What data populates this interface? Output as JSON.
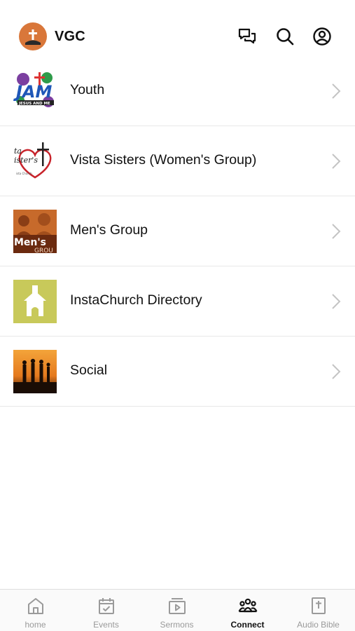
{
  "header": {
    "brand": "VGC",
    "icons": [
      "chat-icon",
      "search-icon",
      "account-icon"
    ]
  },
  "list": [
    {
      "label": "Youth",
      "thumb": "jam-logo"
    },
    {
      "label": "Vista Sisters (Women's Group)",
      "thumb": "heart-cross-logo"
    },
    {
      "label": "Men's Group",
      "thumb": "mens-group-photo"
    },
    {
      "label": "InstaChurch Directory",
      "thumb": "church-icon"
    },
    {
      "label": "Social",
      "thumb": "sunset-silhouette-photo"
    }
  ],
  "tabs": [
    {
      "label": "home",
      "icon": "home-icon",
      "active": false
    },
    {
      "label": "Events",
      "icon": "calendar-icon",
      "active": false
    },
    {
      "label": "Sermons",
      "icon": "video-icon",
      "active": false
    },
    {
      "label": "Connect",
      "icon": "people-icon",
      "active": true
    },
    {
      "label": "Audio Bible",
      "icon": "bible-icon",
      "active": false
    }
  ],
  "colors": {
    "brand_orange": "#d9773a",
    "church_green": "#c8c95a",
    "text": "#111111",
    "inactive_tab": "#9a9a9a"
  }
}
